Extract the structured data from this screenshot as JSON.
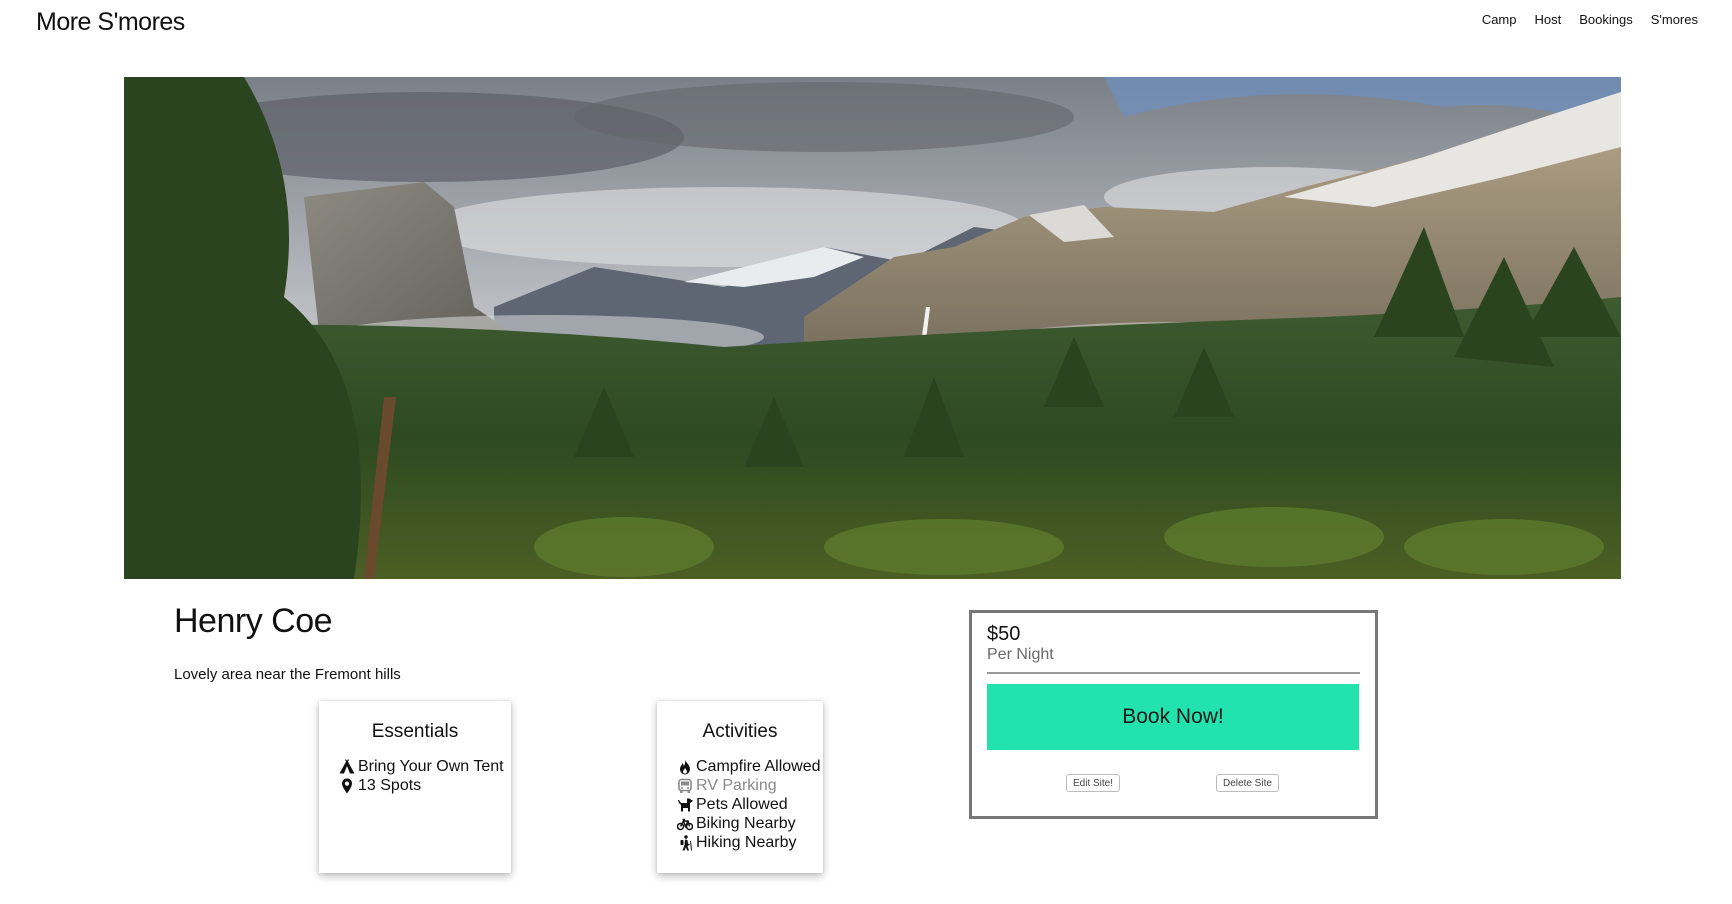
{
  "brand": "More S'mores",
  "nav": [
    "Camp",
    "Host",
    "Bookings",
    "S'mores"
  ],
  "site": {
    "title": "Henry Coe",
    "description": "Lovely area near the Fremont hills"
  },
  "essentials": {
    "heading": "Essentials",
    "items": [
      {
        "icon": "tent-icon",
        "label": "Bring Your Own Tent"
      },
      {
        "icon": "map-pin-icon",
        "label": "13 Spots"
      }
    ]
  },
  "activities": {
    "heading": "Activities",
    "items": [
      {
        "icon": "fire-icon",
        "label": "Campfire Allowed",
        "enabled": true
      },
      {
        "icon": "rv-icon",
        "label": "RV Parking",
        "enabled": false
      },
      {
        "icon": "dog-icon",
        "label": "Pets Allowed",
        "enabled": true
      },
      {
        "icon": "bicycle-icon",
        "label": "Biking Nearby",
        "enabled": true
      },
      {
        "icon": "hiking-icon",
        "label": "Hiking Nearby",
        "enabled": true
      }
    ]
  },
  "booking": {
    "price": "$50",
    "unit": "Per Night",
    "book_label": "Book Now!",
    "edit_label": "Edit Site!",
    "delete_label": "Delete Site"
  },
  "colors": {
    "book_button": "#22e3ad",
    "disabled_text": "#8a8a8a",
    "booking_border": "#777777"
  }
}
